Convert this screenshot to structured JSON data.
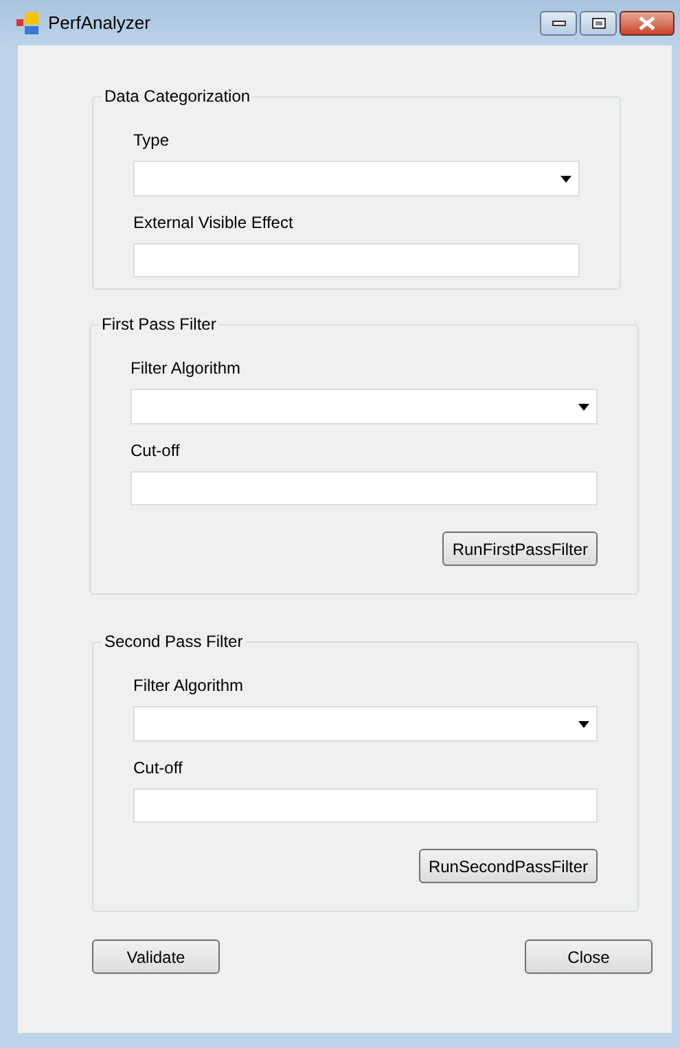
{
  "window": {
    "title": "PerfAnalyzer"
  },
  "groups": [
    {
      "title": "Data Categorization",
      "fields": [
        {
          "label": "Type",
          "kind": "combo"
        },
        {
          "label": "External Visible Effect",
          "kind": "text"
        }
      ]
    },
    {
      "title": "First Pass Filter",
      "fields": [
        {
          "label": "Filter Algorithm",
          "kind": "combo"
        },
        {
          "label": "Cut-off",
          "kind": "text"
        }
      ],
      "button": "RunFirstPassFilter"
    },
    {
      "title": "Second Pass Filter",
      "fields": [
        {
          "label": "Filter Algorithm",
          "kind": "combo"
        },
        {
          "label": "Cut-off",
          "kind": "text"
        }
      ],
      "button": "RunSecondPassFilter"
    }
  ],
  "buttons": [
    "Validate",
    "Close"
  ]
}
